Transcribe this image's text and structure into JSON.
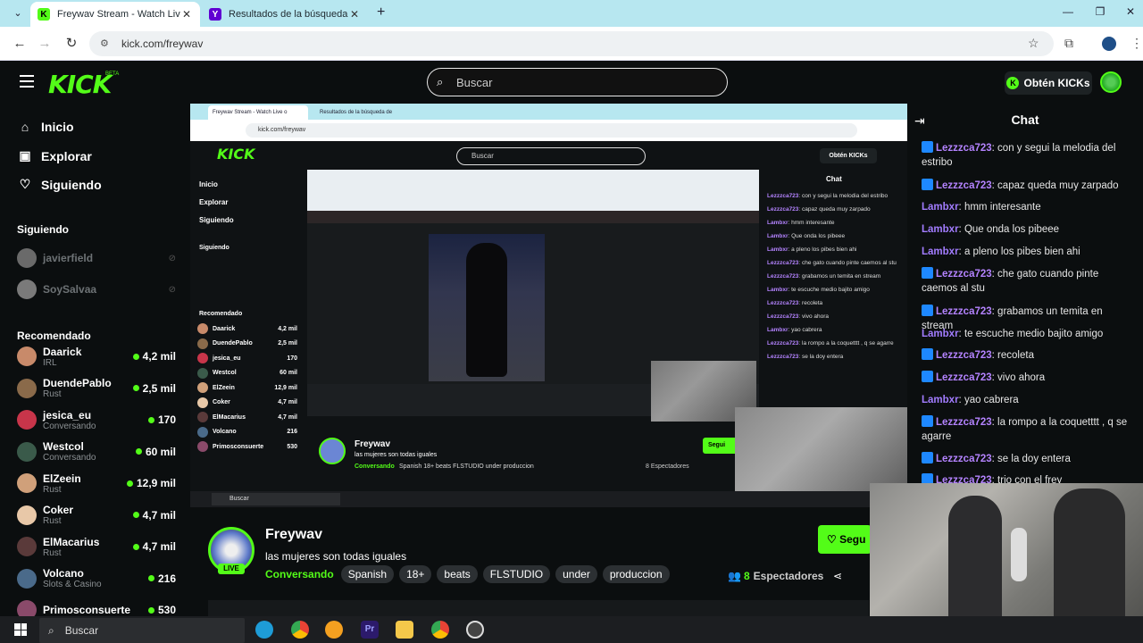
{
  "browser": {
    "tabs": [
      {
        "title": "Freywav Stream - Watch Live o",
        "active": true,
        "favicon_color": "#53fc18"
      },
      {
        "title": "Resultados de la búsqueda de",
        "active": false,
        "favicon_color": "#6001d2"
      }
    ],
    "url": "kick.com/freywav"
  },
  "header": {
    "logo": "KICK",
    "beta": "BETA",
    "search_placeholder": "Buscar",
    "get_kicks_label": "Obtén KICKs"
  },
  "sidebar": {
    "nav": [
      {
        "label": "Inicio",
        "icon": "home-icon"
      },
      {
        "label": "Explorar",
        "icon": "compass-icon"
      },
      {
        "label": "Siguiendo",
        "icon": "heart-icon"
      }
    ],
    "following_title": "Siguiendo",
    "following": [
      {
        "name": "javierfield"
      },
      {
        "name": "SoySalvaa"
      }
    ],
    "recommended_title": "Recomendado",
    "recommended": [
      {
        "name": "Daarick",
        "category": "IRL",
        "viewers": "4,2 mil",
        "color": "#c88a6a"
      },
      {
        "name": "DuendePablo",
        "category": "Rust",
        "viewers": "2,5 mil",
        "color": "#8a6a4a"
      },
      {
        "name": "jesica_eu",
        "category": "Conversando",
        "viewers": "170",
        "color": "#c8354a"
      },
      {
        "name": "Westcol",
        "category": "Conversando",
        "viewers": "60 mil",
        "color": "#3a5a4a"
      },
      {
        "name": "ElZeein",
        "category": "Rust",
        "viewers": "12,9 mil",
        "color": "#d0a07a"
      },
      {
        "name": "Coker",
        "category": "Rust",
        "viewers": "4,7 mil",
        "color": "#e8c8a8"
      },
      {
        "name": "ElMacarius",
        "category": "Rust",
        "viewers": "4,7 mil",
        "color": "#5a3a3a"
      },
      {
        "name": "Volcano",
        "category": "Slots & Casino",
        "viewers": "216",
        "color": "#4a6a8a"
      },
      {
        "name": "Primosconsuerte",
        "category": "",
        "viewers": "530",
        "color": "#8a4a6a"
      }
    ]
  },
  "chat": {
    "title": "Chat",
    "messages": [
      {
        "user": "Lezzzca723",
        "text": "con y segui la melodia del estribo",
        "badge": true
      },
      {
        "user": "Lezzzca723",
        "text": "capaz queda muy zarpado",
        "badge": true
      },
      {
        "user": "Lambxr",
        "text": "hmm interesante",
        "badge": false
      },
      {
        "user": "Lambxr",
        "text": "Que onda los pibeee",
        "badge": false
      },
      {
        "user": "Lambxr",
        "text": "a pleno los pibes bien ahi",
        "badge": false
      },
      {
        "user": "Lezzzca723",
        "text": "che gato cuando pinte caemos al stu",
        "badge": true
      },
      {
        "user": "Lezzzca723",
        "text": "grabamos un temita en stream",
        "badge": true
      },
      {
        "user": "Lambxr",
        "text": "te escuche medio bajito amigo",
        "badge": false
      },
      {
        "user": "Lezzzca723",
        "text": "recoleta",
        "badge": true
      },
      {
        "user": "Lezzzca723",
        "text": "vivo ahora",
        "badge": true
      },
      {
        "user": "Lambxr",
        "text": "yao cabrera",
        "badge": false
      },
      {
        "user": "Lezzzca723",
        "text": "la rompo a la coquetttt , q se agarre",
        "badge": true
      },
      {
        "user": "Lezzzca723",
        "text": "se la doy entera",
        "badge": true
      },
      {
        "user": "Lezzzca723",
        "text": "trio con el frey",
        "badge": true
      }
    ]
  },
  "stream": {
    "name": "Freywav",
    "live": "LIVE",
    "title": "las mujeres son todas iguales",
    "category": "Conversando",
    "tags": [
      "Spanish",
      "18+",
      "beats",
      "FLSTUDIO",
      "under",
      "produccion"
    ],
    "viewers_count": "8",
    "viewers_label": "Espectadores",
    "follow_label": "Segu"
  },
  "taskbar": {
    "search_placeholder": "Buscar"
  },
  "video_inner": {
    "omni": "kick.com/freywav",
    "search": "Buscar",
    "get_kicks": "Obtén KICKs",
    "nav": [
      "Inicio",
      "Explorar",
      "Siguiendo"
    ],
    "following_title": "Siguiendo",
    "recommended_title": "Recomendado",
    "chat_title": "Chat",
    "streamer": "Freywav",
    "stream_title": "las mujeres son todas iguales",
    "category": "Conversando",
    "tags": "Spanish  18+  beats  FLSTUDIO  under  produccion",
    "viewers": "8 Espectadores",
    "follow": "Segui",
    "taskbar_search": "Buscar"
  }
}
